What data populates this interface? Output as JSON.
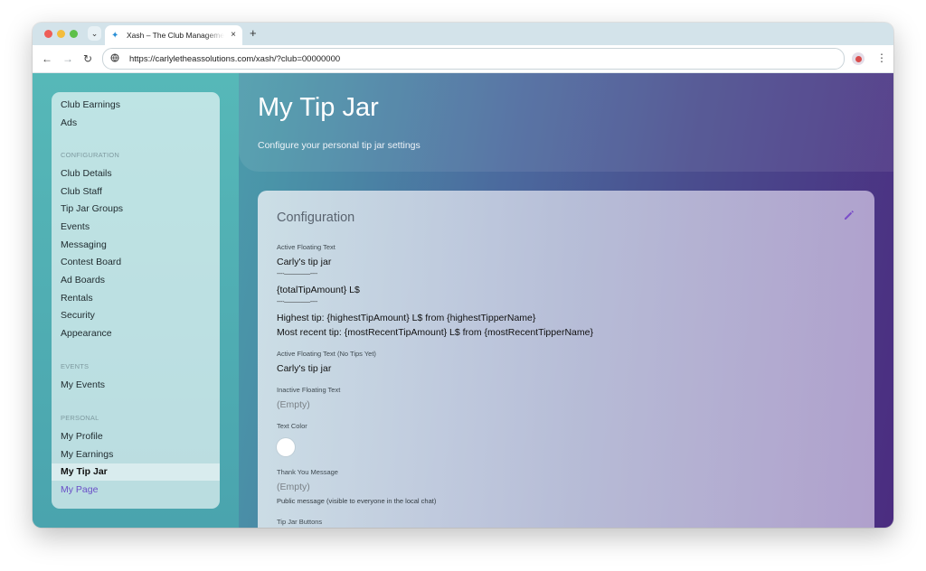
{
  "browser": {
    "tab_title": "Xash – The Club Management",
    "tab_close": "×",
    "new_tab": "+",
    "dropdown": "⌄",
    "url": "https://carlyletheassolutions.com/xash/?club=00000000",
    "nav": {
      "back": "←",
      "forward": "→",
      "reload": "↻",
      "menu": "⋮"
    }
  },
  "sidebar": {
    "top_items": [
      "Club Earnings",
      "Ads"
    ],
    "sections": [
      {
        "label": "CONFIGURATION",
        "items": [
          "Club Details",
          "Club Staff",
          "Tip Jar Groups",
          "Events",
          "Messaging",
          "Contest Board",
          "Ad Boards",
          "Rentals",
          "Security",
          "Appearance"
        ]
      },
      {
        "label": "EVENTS",
        "items": [
          "My Events"
        ]
      },
      {
        "label": "PERSONAL",
        "items": [
          "My Profile",
          "My Earnings",
          "My Tip Jar",
          "My Page"
        ]
      }
    ],
    "active_item": "My Tip Jar"
  },
  "header": {
    "title": "My Tip Jar",
    "subtitle": "Configure your personal tip jar settings"
  },
  "card": {
    "title": "Configuration",
    "fields": {
      "active_text": {
        "label": "Active Floating Text",
        "lines": [
          "Carly's tip jar",
          "----‒‒‒‒‒‒‒‒----",
          "{totalTipAmount} L$",
          "----‒‒‒‒‒‒‒‒----",
          "Highest tip: {highestTipAmount} L$ from {highestTipperName}",
          "Most recent tip: {mostRecentTipAmount} L$ from {mostRecentTipperName}"
        ]
      },
      "no_tips_text": {
        "label": "Active Floating Text (No Tips Yet)",
        "value": "Carly's tip jar"
      },
      "inactive_text": {
        "label": "Inactive Floating Text",
        "value": "(Empty)"
      },
      "text_color": {
        "label": "Text Color",
        "value": "#ffffff"
      },
      "thank_you": {
        "label": "Thank You Message",
        "value": "(Empty)",
        "help": "Public message (visible to everyone in the local chat)"
      },
      "buttons": {
        "label": "Tip Jar Buttons"
      }
    }
  },
  "colors": {
    "accent": "#6a4fc8",
    "edit_icon": "#7b4fc9"
  }
}
